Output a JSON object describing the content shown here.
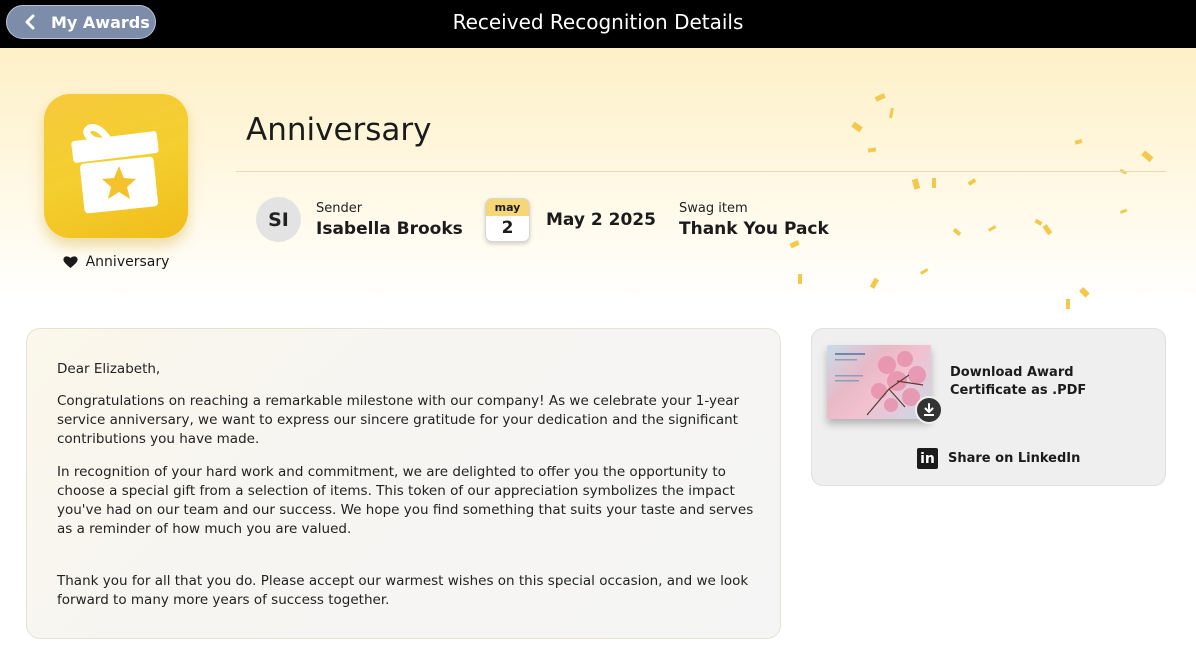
{
  "header": {
    "back_label": "My Awards",
    "title": "Received Recognition Details"
  },
  "award": {
    "title": "Anniversary",
    "caption": "Anniversary",
    "icon": "gift-star-icon",
    "tile_color": "#f4cf2f"
  },
  "sender": {
    "label": "Sender",
    "initials": "SI",
    "name": "Isabella Brooks"
  },
  "date": {
    "month": "may",
    "day": "2",
    "full": "May 2 2025"
  },
  "swag": {
    "label": "Swag item",
    "value": "Thank You Pack"
  },
  "message": {
    "greeting": "Dear Elizabeth,",
    "paragraph1": "Congratulations on reaching a remarkable milestone with our company! As we celebrate your 1-year service anniversary, we want to express our sincere gratitude for your dedication and the significant contributions you have made.",
    "paragraph2": "In recognition of your hard work and commitment, we are delighted to offer you the opportunity to choose a special gift from a selection of items. This token of our appreciation symbolizes the impact you've had on our team and our success. We hope you find something that suits your taste and serves as a reminder of how much you are valued.",
    "paragraph3": "Thank you for all that you do. Please accept our warmest wishes on this special occasion, and we look forward to many more years of success together."
  },
  "certificate": {
    "download_label": "Download Award Certificate as .PDF",
    "share_label": "Share on LinkedIn"
  },
  "colors": {
    "topbar": "#000000",
    "back_button": "#7d8da9",
    "accent_yellow": "#f4cf2f"
  }
}
